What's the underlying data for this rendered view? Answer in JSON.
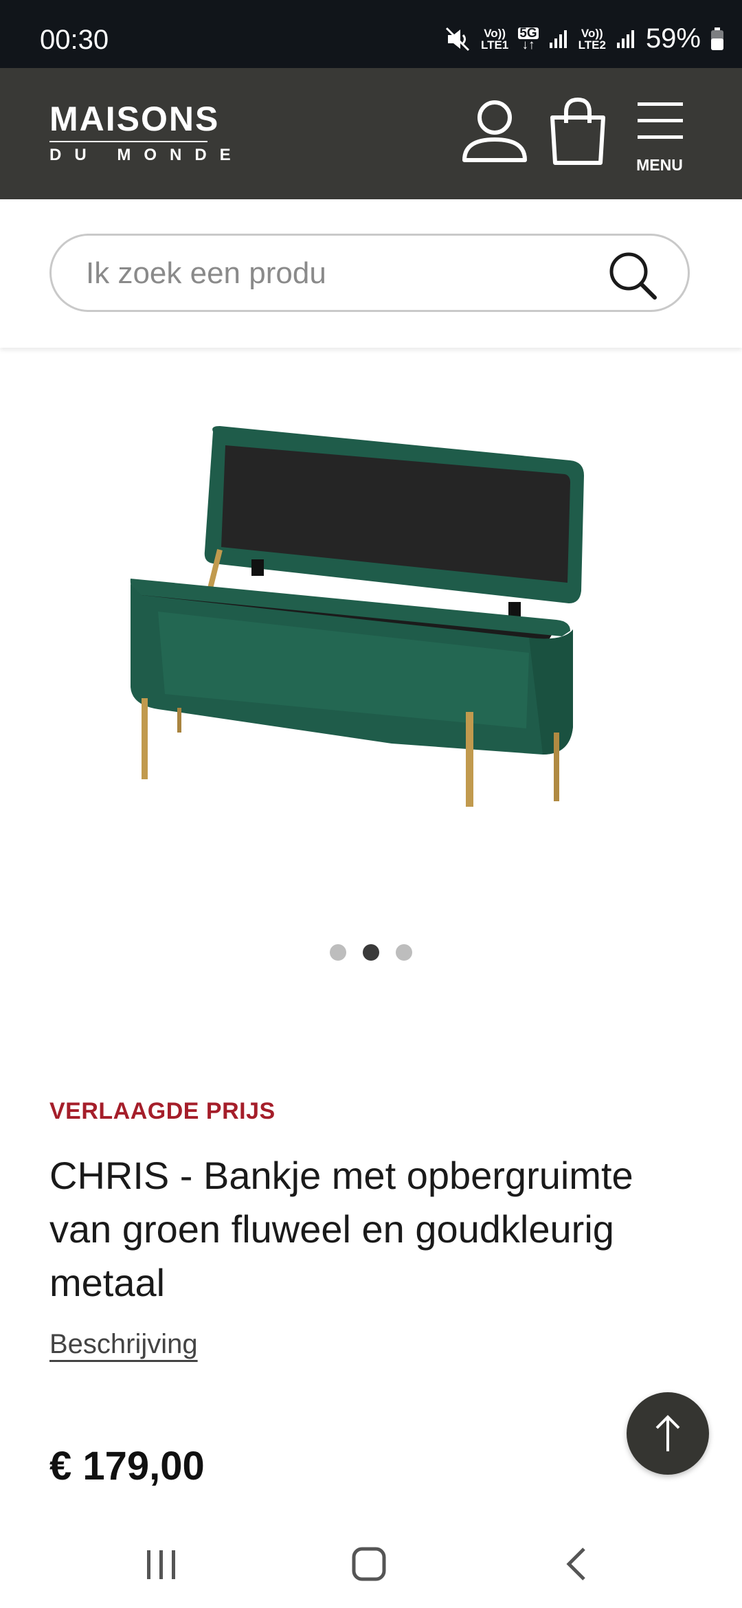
{
  "status_bar": {
    "time": "00:30",
    "sim1": [
      "Vo))",
      "LTE1"
    ],
    "network": "5G",
    "sim2": [
      "Vo))",
      "LTE2"
    ],
    "battery": "59%"
  },
  "header": {
    "brand_line1": "MAISONS",
    "brand_line2": "DU MONDE",
    "menu_label": "MENU",
    "icons": [
      "account-icon",
      "cart-icon",
      "hamburger-icon"
    ]
  },
  "search": {
    "placeholder": "Ik zoek een produ",
    "value": ""
  },
  "carousel": {
    "total": 3,
    "active_index": 1
  },
  "product": {
    "badge": "VERLAAGDE PRIJS",
    "title": "CHRIS - Bankje met opbergruimte van groen fluweel en goudkleurig metaal",
    "description_link": "Beschrijving",
    "price": "€ 179,00"
  },
  "colors": {
    "status_bar_bg": "#11151a",
    "header_bg": "#393936",
    "badge": "#a51e2a",
    "velvet_green": "#1f5c4a",
    "gold": "#c19a4e"
  }
}
